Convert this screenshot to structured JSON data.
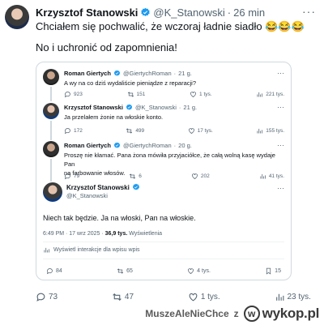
{
  "post": {
    "author_name": "Krzysztof Stanowski",
    "handle": "@K_Stanowski",
    "separator": "·",
    "time": "26 min",
    "more": "···",
    "line1": "Chciałem się pochwalić, że wczoraj ładnie siadło 😂😂😂",
    "line2": "No i uchronić od zapomnienia!",
    "actions": {
      "replies": "73",
      "reposts": "47",
      "likes": "1 tys.",
      "views": "23 tys."
    }
  },
  "quote": {
    "tweets": [
      {
        "author_name": "Roman Giertych",
        "handle": "@GiertychRoman",
        "time": "21 g.",
        "text": "A wy na co dziś wydaliście pieniądze z reparacji?",
        "actions": {
          "replies": "923",
          "reposts": "151",
          "likes": "1 tys.",
          "views": "221 tys."
        }
      },
      {
        "author_name": "Krzysztof Stanowski",
        "handle": "@K_Stanowski",
        "time": "21 g.",
        "text": "Ja przelałem żonie na włoskie konto.",
        "actions": {
          "replies": "172",
          "reposts": "499",
          "likes": "17 tys.",
          "views": "155 tys."
        }
      },
      {
        "author_name": "Roman Giertych",
        "handle": "@GiertychRoman",
        "time": "20 g.",
        "text_line1": "Proszę nie kłamać. Pana żona mówiła przyjaciółce, że całą wolną kasę wydaje Pan",
        "text_line2": "na farbowanie włosów.",
        "actions": {
          "replies": "79",
          "reposts": "6",
          "likes": "202",
          "views": "41 tys."
        }
      }
    ],
    "main": {
      "author_name": "Krzysztof Stanowski",
      "handle": "@K_Stanowski",
      "text": "Niech tak będzie. Ja na włoski, Pan na włoskie.",
      "time": "6:49 PM · 17 wrz 2025 ·",
      "views_count": "36,9 tys.",
      "views_label": "Wyświetlenia",
      "interactions": "Wyświetl interakcje dla wpisu wpis",
      "actions": {
        "replies": "84",
        "reposts": "65",
        "likes": "4 tys.",
        "bookmarks": "15"
      }
    }
  },
  "watermark": {
    "username": "MuszeAleNieChce",
    "prefix": "z",
    "site": "wykop.pl"
  },
  "colors": {
    "verified": "#1d9bf0",
    "muted": "#536471",
    "border": "#cfd9de"
  }
}
